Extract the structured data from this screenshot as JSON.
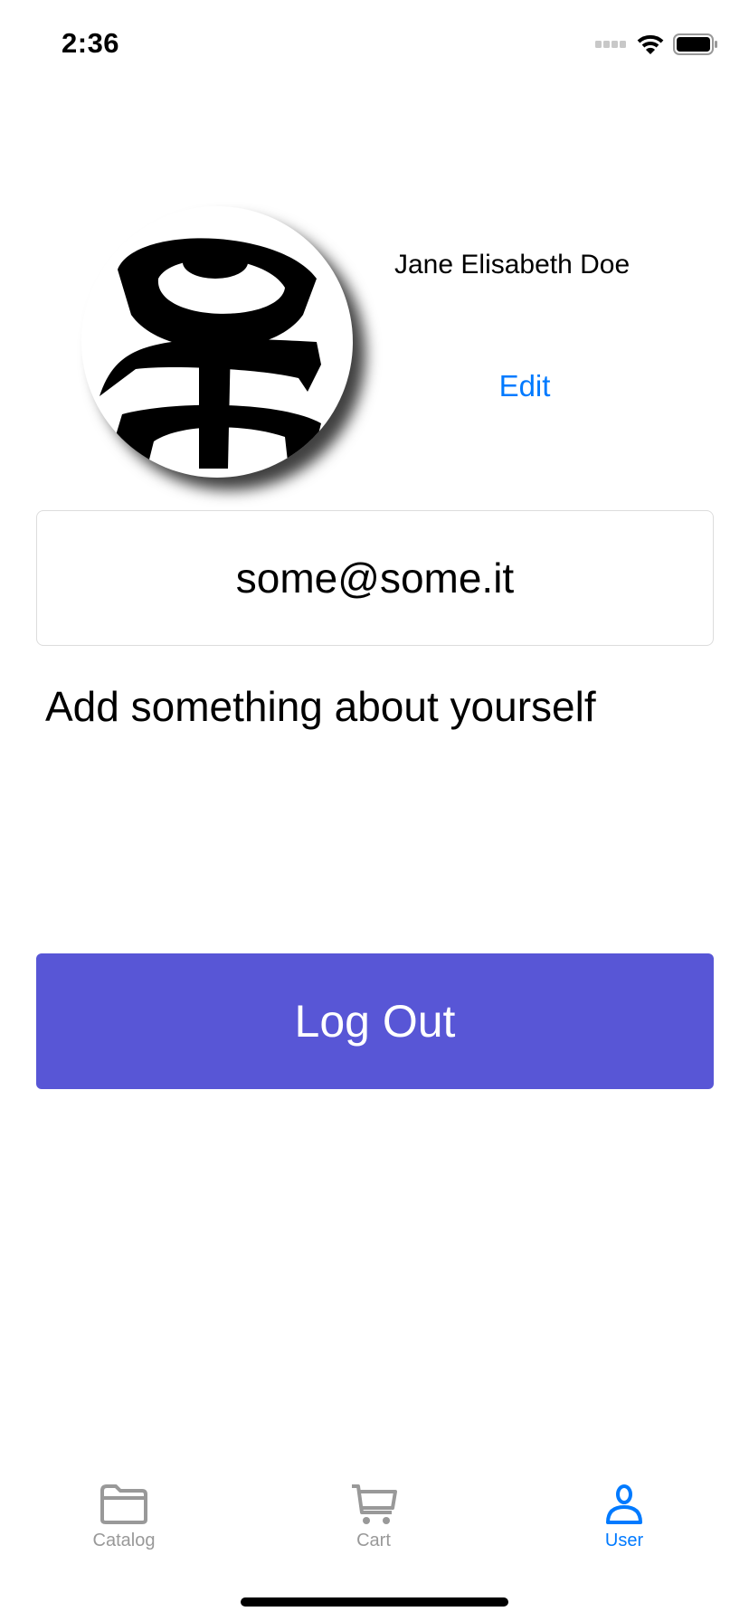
{
  "status_bar": {
    "time": "2:36",
    "icons": [
      "signal-icon",
      "wifi-icon",
      "battery-icon"
    ]
  },
  "profile": {
    "name": "Jane Elisabeth Doe",
    "edit_label": "Edit",
    "email": "some@some.it",
    "about_placeholder": "Add something about yourself"
  },
  "actions": {
    "logout_label": "Log Out",
    "logout_color": "#5856d6"
  },
  "tab_bar": {
    "items": [
      {
        "label": "Catalog",
        "icon": "folder-icon",
        "active": false
      },
      {
        "label": "Cart",
        "icon": "cart-icon",
        "active": false
      },
      {
        "label": "User",
        "icon": "user-icon",
        "active": true
      }
    ],
    "active_color": "#007aff",
    "inactive_color": "#999999"
  }
}
